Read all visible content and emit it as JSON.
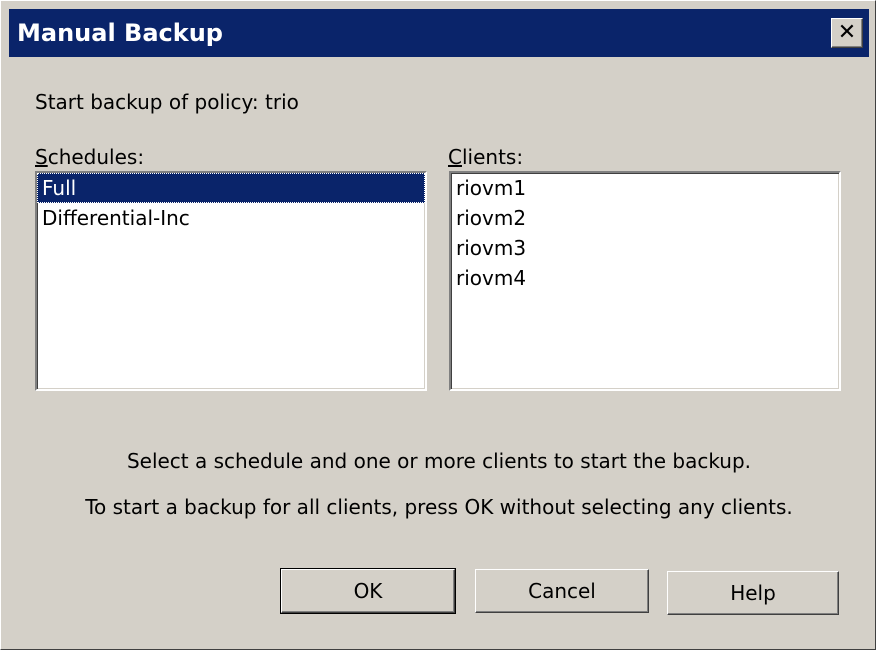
{
  "window": {
    "title": "Manual Backup",
    "close_glyph": "✕"
  },
  "policy_line": "Start backup of policy:  trio",
  "schedules": {
    "label_mnemonic": "S",
    "label_rest": "chedules:",
    "items": [
      "Full",
      "Differential-Inc"
    ],
    "selected_index": 0
  },
  "clients": {
    "label_mnemonic": "C",
    "label_rest": "lients:",
    "items": [
      "riovm1",
      "riovm2",
      "riovm3",
      "riovm4"
    ]
  },
  "instructions": {
    "line1": "Select a schedule and one or more clients to start the backup.",
    "line2": "To start a backup for all clients, press OK without selecting any clients."
  },
  "buttons": {
    "ok": "OK",
    "cancel": "Cancel",
    "help": "Help"
  },
  "colors": {
    "title_bar": "#0a246a",
    "dialog_bg": "#d4d0c8",
    "selection": "#0a246a"
  }
}
